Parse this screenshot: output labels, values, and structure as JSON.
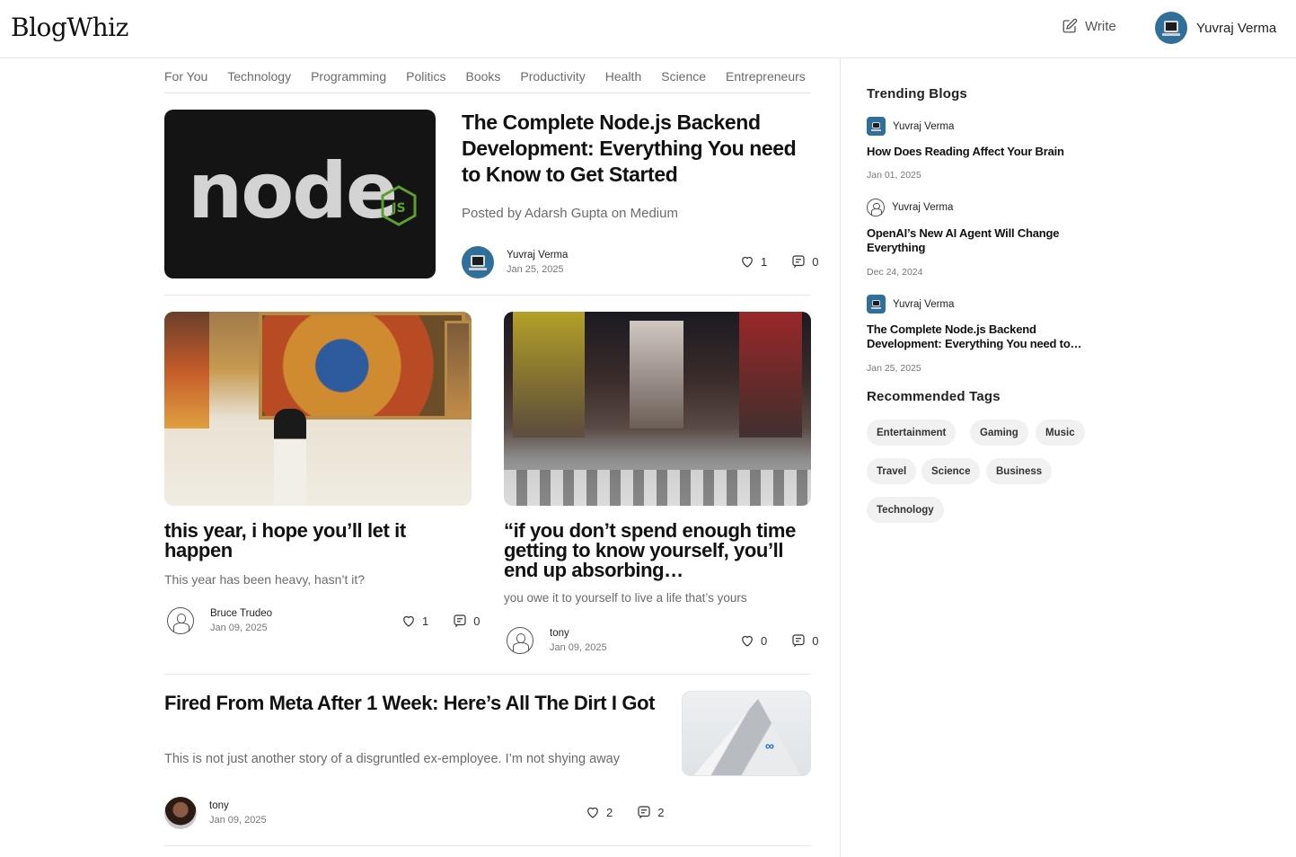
{
  "header": {
    "logo": "BlogWhiz",
    "write_label": "Write",
    "user_name": "Yuvraj Verma"
  },
  "tabs": [
    "For You",
    "Technology",
    "Programming",
    "Politics",
    "Books",
    "Productivity",
    "Health",
    "Science",
    "Entrepreneurs"
  ],
  "articles": [
    {
      "title": "The Complete Node.js Backend Development: Everything You need to Know to Get Started",
      "excerpt": "Posted by Adarsh Gupta on Medium",
      "author": "Yuvraj Verma",
      "date": "Jan 25, 2025",
      "likes": "1",
      "comments": "0",
      "thumb_text": "node",
      "thumb_badge": "JS"
    },
    {
      "title": "this year, i hope you’ll let it happen",
      "excerpt": "This year has been heavy, hasn’t it?",
      "author": "Bruce Trudeo",
      "date": "Jan 09, 2025",
      "likes": "1",
      "comments": "0"
    },
    {
      "title": "“if you don’t spend enough time getting to know yourself, you’ll end up absorbing…",
      "excerpt": "you owe it to yourself to live a life that’s yours",
      "author": "tony",
      "date": "Jan 09, 2025",
      "likes": "0",
      "comments": "0"
    },
    {
      "title": "Fired From Meta After 1 Week: Here’s All The Dirt I Got",
      "excerpt": "This is not just another story of a disgruntled ex-employee. I’m not shying away",
      "author": "tony",
      "date": "Jan 09, 2025",
      "likes": "2",
      "comments": "2",
      "thumb_text": "∞"
    }
  ],
  "sidebar": {
    "trending_heading": "Trending Blogs",
    "trending": [
      {
        "author": "Yuvraj Verma",
        "title": "How Does Reading Affect Your Brain",
        "date": "Jan 01, 2025"
      },
      {
        "author": "Yuvraj Verma",
        "title": "OpenAI’s New AI Agent Will Change Everything",
        "date": "Dec 24, 2024"
      },
      {
        "author": "Yuvraj Verma",
        "title": "The Complete Node.js Backend Development: Everything You need to…",
        "date": "Jan 25, 2025"
      }
    ],
    "tags_heading": "Recommended Tags",
    "tags": [
      "Entertainment",
      "Gaming",
      "Music",
      "Travel",
      "Science",
      "Business",
      "Technology"
    ]
  },
  "icons": {
    "write": "edit-square-icon",
    "like": "heart-icon",
    "comment": "comment-icon",
    "default_avatar": "user-circle-icon"
  },
  "colors": {
    "accent_green": "#5aa02c",
    "meta_blue": "#1c6fd1"
  }
}
